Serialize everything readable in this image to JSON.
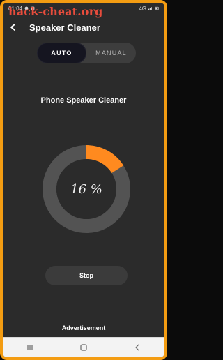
{
  "status_bar": {
    "time": "01:04",
    "network": "4G"
  },
  "watermark": {
    "text": "hack-cheat.org"
  },
  "header": {
    "title": "Speaker Cleaner",
    "back_icon": "arrow-left-icon"
  },
  "mode_toggle": {
    "options": [
      {
        "label": "AUTO",
        "selected": true
      },
      {
        "label": "MANUAL",
        "selected": false
      }
    ]
  },
  "main": {
    "title": "Phone Speaker Cleaner",
    "progress": {
      "percent_label": "16 %",
      "fraction": 0.16,
      "track_color": "#535353",
      "fill_color": "#ff8a1f",
      "center_color": "#2b2b2b"
    },
    "stop_label": "Stop",
    "ad_label": "Advertisement"
  },
  "nav": {
    "recents_icon": "recents-icon",
    "home_icon": "home-icon",
    "back_icon": "back-icon"
  },
  "colors": {
    "frame_border": "#f39c12",
    "background": "#2b2b2b",
    "accent": "#ff8a1f"
  }
}
